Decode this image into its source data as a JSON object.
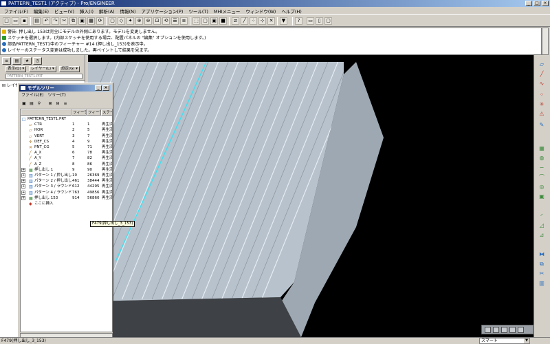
{
  "window": {
    "title": "PATTERN_TEST1 (アクティブ) - Pro/ENGINEER"
  },
  "menu": [
    "ファイル(F)",
    "編集(E)",
    "ビュー(V)",
    "挿入(I)",
    "解析(A)",
    "情報(N)",
    "アプリケーション(P)",
    "ツール(T)",
    "MHIメニュー",
    "ウィンドウ(W)",
    "ヘルプ(H)"
  ],
  "messages": [
    {
      "icon": "warning-icon",
      "text": "警告: 押し出し 153は完全にモデルの外側にあります。モデルを変更しません。"
    },
    {
      "icon": "info-icon",
      "text": "スケッチを選択します。(内部スケッチを使用する場合、配置パネルの \"編集\" オプションを使用します。)"
    },
    {
      "icon": "bullet-icon",
      "text": "部品PATTERN_TEST1中のフィーチャー #14 (押し出し_153)を表示中。"
    },
    {
      "icon": "bullet-icon",
      "text": "レイヤーのステータス変更は成功しました。再ペイントして結果を見ます。"
    }
  ],
  "nav": {
    "show_label": "表示(Q)",
    "layer_label": "レイヤー(L)",
    "settings_label": "設定(G)",
    "search_value": "PATTERN_TEST1.PRT",
    "tree_root": "レイヤー"
  },
  "model_tree": {
    "title": "モデルツリー",
    "menu": [
      "ファイル(E)",
      "ツリー(T)"
    ],
    "columns": [
      "",
      "フィーチ...",
      "フィーチャ...",
      "ステータ..."
    ],
    "rows": [
      {
        "name": "PATTERN_TEST1.PRT",
        "c1": "",
        "c2": "",
        "status": "",
        "icon": "part-icon",
        "expand": "",
        "indent": 0
      },
      {
        "name": "CTR",
        "c1": "1",
        "c2": "1",
        "status": "再生済",
        "icon": "datum-plane-icon",
        "expand": "",
        "indent": 1
      },
      {
        "name": "HOR",
        "c1": "2",
        "c2": "5",
        "status": "再生済",
        "icon": "datum-plane-icon",
        "expand": "",
        "indent": 1
      },
      {
        "name": "VERT",
        "c1": "3",
        "c2": "7",
        "status": "再生済",
        "icon": "datum-plane-icon",
        "expand": "",
        "indent": 1
      },
      {
        "name": "DEF_CS",
        "c1": "4",
        "c2": "9",
        "status": "再生済",
        "icon": "coordinate-system-icon",
        "expand": "",
        "indent": 1
      },
      {
        "name": "PNT_CG",
        "c1": "5",
        "c2": "71",
        "status": "再生済",
        "icon": "datum-point-icon",
        "expand": "",
        "indent": 1
      },
      {
        "name": "A_X",
        "c1": "6",
        "c2": "78",
        "status": "再生済",
        "icon": "datum-axis-icon",
        "expand": "",
        "indent": 1
      },
      {
        "name": "A_Y",
        "c1": "7",
        "c2": "82",
        "status": "再生済",
        "icon": "datum-axis-icon",
        "expand": "",
        "indent": 1
      },
      {
        "name": "A_Z",
        "c1": "8",
        "c2": "86",
        "status": "再生済",
        "icon": "datum-axis-icon",
        "expand": "",
        "indent": 1
      },
      {
        "name": "押し出し 1",
        "c1": "9",
        "c2": "90",
        "status": "再生済",
        "icon": "extrude-icon",
        "expand": "+",
        "indent": 1
      },
      {
        "name": "パターン 1 / 押し出し 2",
        "c1": "10",
        "c2": "26369",
        "status": "再生済",
        "icon": "pattern-icon",
        "expand": "+",
        "indent": 1
      },
      {
        "name": "パターン 2 / 押し出し 3",
        "c1": "461",
        "c2": "38444",
        "status": "再生済",
        "icon": "pattern-icon",
        "expand": "+",
        "indent": 1
      },
      {
        "name": "パターン 3 / ラウンド 1",
        "c1": "612",
        "c2": "44295",
        "status": "再生済",
        "icon": "pattern-icon",
        "expand": "+",
        "indent": 1
      },
      {
        "name": "パターン 4 / ラウンド 2",
        "c1": "763",
        "c2": "49856",
        "status": "再生済",
        "icon": "pattern-icon",
        "expand": "+",
        "indent": 1
      },
      {
        "name": "押し出し 153",
        "c1": "914",
        "c2": "56860",
        "status": "再生済",
        "icon": "extrude-icon",
        "expand": "+",
        "indent": 1
      },
      {
        "name": "ここに挿入",
        "c1": "",
        "c2": "",
        "status": "",
        "icon": "insert-here-icon",
        "expand": "",
        "indent": 1
      }
    ]
  },
  "tooltip": "F479(押し出し_3_153)",
  "status_bar": {
    "text": "F479(押し出し_3_153)",
    "filter": "スマート"
  },
  "colors": {
    "viewport_bg": "#000000",
    "part_face": "#b8c2cc",
    "part_side": "#9ea8b2",
    "highlight": "#40e0f0",
    "title_bar": "#0a246a"
  }
}
